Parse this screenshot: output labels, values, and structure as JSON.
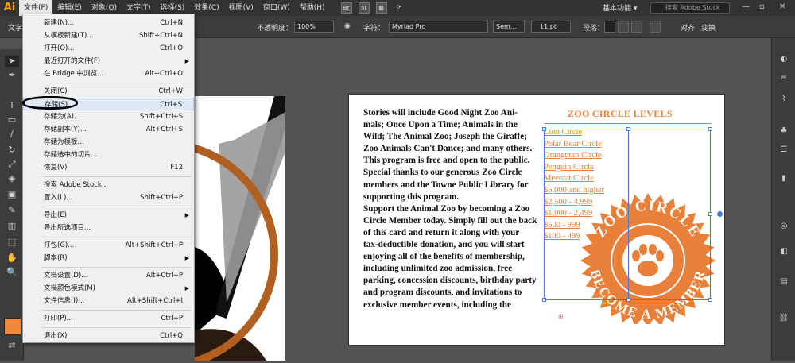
{
  "app": {
    "logo": "Ai"
  },
  "menubar": {
    "items": [
      "文件(F)",
      "编辑(E)",
      "对象(O)",
      "文字(T)",
      "选择(S)",
      "效果(C)",
      "视图(V)",
      "窗口(W)",
      "帮助(H)"
    ],
    "workspace": "基本功能 ▾",
    "search_placeholder": "搜索 Adobe Stock",
    "mini_buttons": [
      "Br",
      "St"
    ]
  },
  "controlbar": {
    "left_label": "文字",
    "opacity_label": "不透明度：",
    "opacity_value": "100%",
    "char_label": "字符：",
    "font": "Myriad Pro",
    "style": "Sem...",
    "size": "11 pt",
    "para_label": "段落：",
    "align_label": "对齐",
    "transform_label": "变换"
  },
  "file_menu": {
    "items": [
      {
        "label": "新建(N)...",
        "shortcut": "Ctrl+N"
      },
      {
        "label": "从模板新建(T)...",
        "shortcut": "Shift+Ctrl+N"
      },
      {
        "label": "打开(O)...",
        "shortcut": "Ctrl+O"
      },
      {
        "label": "最近打开的文件(F)",
        "shortcut": "",
        "submenu": true
      },
      {
        "label": "在 Bridge 中浏览...",
        "shortcut": "Alt+Ctrl+O"
      },
      {
        "label": "关闭(C)",
        "shortcut": "Ctrl+W"
      },
      {
        "label": "存储(S)",
        "shortcut": "Ctrl+S",
        "highlighted": true
      },
      {
        "label": "存储为(A)...",
        "shortcut": "Shift+Ctrl+S"
      },
      {
        "label": "存储副本(Y)...",
        "shortcut": "Alt+Ctrl+S"
      },
      {
        "label": "存储为模板...",
        "shortcut": ""
      },
      {
        "label": "存储选中的切片...",
        "shortcut": ""
      },
      {
        "label": "恢复(V)",
        "shortcut": "F12"
      },
      {
        "label": "搜索 Adobe Stock...",
        "shortcut": ""
      },
      {
        "label": "置入(L)...",
        "shortcut": "Shift+Ctrl+P"
      },
      {
        "label": "导出(E)",
        "shortcut": "",
        "submenu": true
      },
      {
        "label": "导出所选项目...",
        "shortcut": ""
      },
      {
        "label": "打包(G)...",
        "shortcut": "Alt+Shift+Ctrl+P"
      },
      {
        "label": "脚本(R)",
        "shortcut": "",
        "submenu": true
      },
      {
        "label": "文档设置(D)...",
        "shortcut": "Alt+Ctrl+P"
      },
      {
        "label": "文档颜色模式(M)",
        "shortcut": "",
        "submenu": true
      },
      {
        "label": "文件信息(I)...",
        "shortcut": "Alt+Shift+Ctrl+I"
      },
      {
        "label": "打印(P)...",
        "shortcut": "Ctrl+P"
      },
      {
        "label": "退出(X)",
        "shortcut": "Ctrl+Q"
      }
    ]
  },
  "document": {
    "body_lines": [
      "Stories will include Good Night Zoo Ani-",
      "mals; Once Upon a Time; Animals in the",
      "Wild; The Animal Zoo; Joseph the Giraffe;",
      "Zoo Animals Can't Dance; and many others.",
      "This program is free and open to the public.",
      "Special thanks to our generous Zoo Circle",
      "members and the Towne Public Library for",
      "supporting this program.",
      "Support the Animal Zoo by becoming a Zoo",
      "Circle Member today. Simply fill out the back",
      "of this card and return it along with your",
      "tax-deductible donation, and you will start",
      "enjoying all of the benefits of membership,",
      "including unlimited zoo admission, free",
      "parking, concession discounts, birthday party",
      "and program discounts, and invitations to",
      "exclusive member events, including the"
    ],
    "levels_title": "ZOO CIRCLE LEVELS",
    "levels": [
      "Lion Circle",
      "Polar Bear Circle",
      "Orangutan Circle",
      "Penguin Circle",
      "Meercat Circle",
      "$5,000  and higher",
      "$2,500 - 4,999",
      "$1,000 - 2,499",
      "$500 - 999",
      "$100 - 499"
    ],
    "seal_top_text": "ZOO CIRCLE",
    "seal_bottom_text": "BECOME A MEMBER"
  },
  "colors": {
    "accent_orange": "#e8803a",
    "menu_bg": "#f0f0f0",
    "ui_dark": "#323232"
  }
}
